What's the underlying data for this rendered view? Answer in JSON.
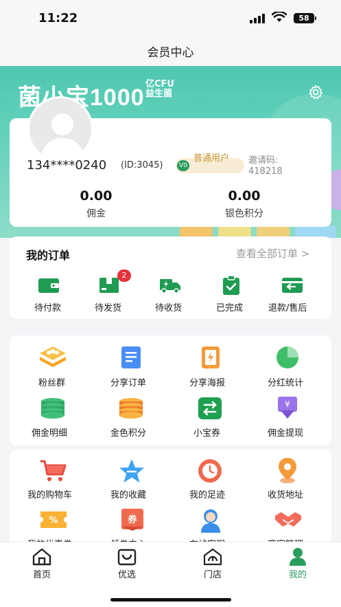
{
  "status_bar": {
    "time": "11:22",
    "battery": "58"
  },
  "nav": {
    "title": "会员中心"
  },
  "banner": {
    "brand": "菌小宝1000",
    "brand_sub_top": "亿CFU",
    "brand_sub_bottom": "益生菌",
    "accent": "#4fc7b1"
  },
  "user": {
    "phone": "134****0240",
    "id_text": "(ID:3045)",
    "level_code": "V0",
    "level_name": "普通用户",
    "invite_label": "邀请码:",
    "invite_code": "418218",
    "stats": [
      {
        "value": "0.00",
        "label": "佣金"
      },
      {
        "value": "0.00",
        "label": "银色积分"
      }
    ]
  },
  "orders": {
    "title": "我的订单",
    "view_all": "查看全部订单 >",
    "items": [
      {
        "label": "待付款",
        "icon": "wallet-icon"
      },
      {
        "label": "待发货",
        "icon": "package-icon",
        "badge": "2"
      },
      {
        "label": "待收货",
        "icon": "truck-icon"
      },
      {
        "label": "已完成",
        "icon": "clipboard-check-icon"
      },
      {
        "label": "退款/售后",
        "icon": "refund-icon"
      }
    ]
  },
  "features": [
    {
      "label": "粉丝群",
      "icon": "fans-group-icon"
    },
    {
      "label": "分享订单",
      "icon": "share-order-icon"
    },
    {
      "label": "分享海报",
      "icon": "share-poster-icon"
    },
    {
      "label": "分红统计",
      "icon": "pie-chart-icon"
    },
    {
      "label": "佣金明细",
      "icon": "coins-stack-icon"
    },
    {
      "label": "金色积分",
      "icon": "gold-coins-icon"
    },
    {
      "label": "小宝券",
      "icon": "exchange-icon"
    },
    {
      "label": "佣金提现",
      "icon": "withdraw-icon"
    }
  ],
  "services": [
    {
      "label": "我的购物车",
      "icon": "cart-icon"
    },
    {
      "label": "我的收藏",
      "icon": "star-icon"
    },
    {
      "label": "我的足迹",
      "icon": "clock-icon"
    },
    {
      "label": "收货地址",
      "icon": "location-icon"
    },
    {
      "label": "我的优惠券",
      "icon": "coupon-icon"
    },
    {
      "label": "领券中心",
      "icon": "ticket-icon"
    },
    {
      "label": "在线客服",
      "icon": "support-icon"
    },
    {
      "label": "商家管理",
      "icon": "handshake-icon"
    }
  ],
  "tabs": [
    {
      "label": "首页",
      "icon": "home-icon"
    },
    {
      "label": "优选",
      "icon": "bag-icon"
    },
    {
      "label": "门店",
      "icon": "store-icon"
    },
    {
      "label": "我的",
      "icon": "person-icon",
      "active": true,
      "color": "#2a9d5e"
    }
  ]
}
